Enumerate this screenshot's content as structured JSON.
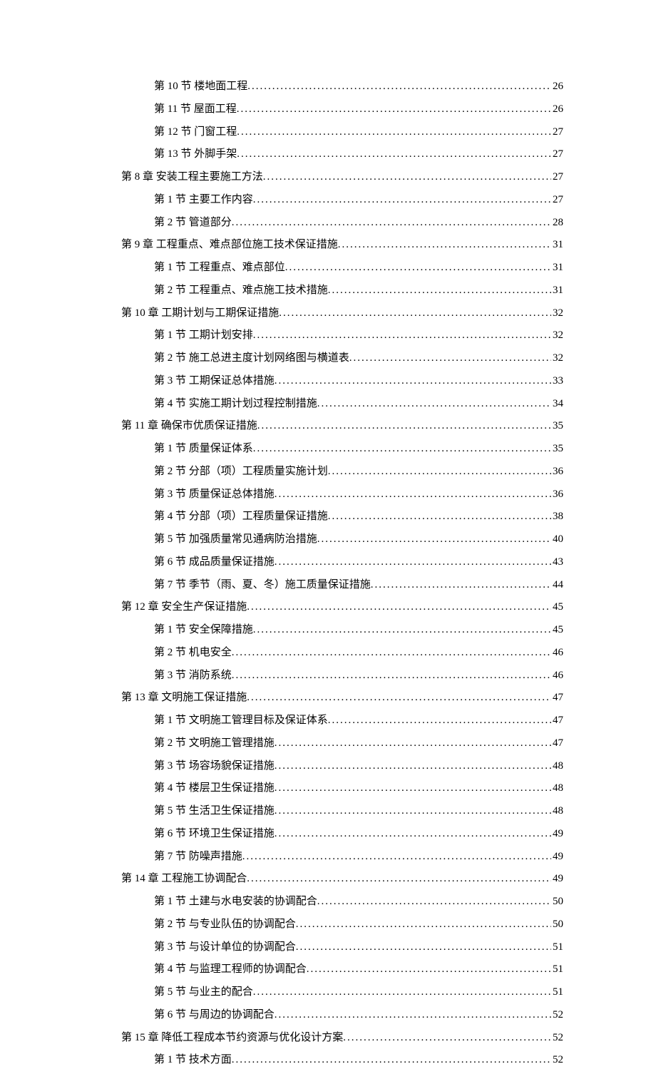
{
  "entries": [
    {
      "level": 2,
      "title": "第 10 节  楼地面工程",
      "page": "26"
    },
    {
      "level": 2,
      "title": "第 11 节  屋面工程",
      "page": "26"
    },
    {
      "level": 2,
      "title": "第 12 节  门窗工程",
      "page": "27"
    },
    {
      "level": 2,
      "title": "第 13 节  外脚手架",
      "page": "27"
    },
    {
      "level": 1,
      "title": "第 8 章  安装工程主要施工方法",
      "page": "27"
    },
    {
      "level": 2,
      "title": "第 1 节  主要工作内容",
      "page": "27"
    },
    {
      "level": 2,
      "title": "第 2 节  管道部分",
      "page": "28"
    },
    {
      "level": 1,
      "title": "第 9 章  工程重点、难点部位施工技术保证措施",
      "page": "31"
    },
    {
      "level": 2,
      "title": "第 1 节  工程重点、难点部位",
      "page": "31"
    },
    {
      "level": 2,
      "title": "第 2 节  工程重点、难点施工技术措施",
      "page": "31"
    },
    {
      "level": 1,
      "title": "第 10 章  工期计划与工期保证措施",
      "page": "32"
    },
    {
      "level": 2,
      "title": "第 1 节  工期计划安排",
      "page": "32"
    },
    {
      "level": 2,
      "title": "第 2 节  施工总进主度计划网络图与横道表",
      "page": "32"
    },
    {
      "level": 2,
      "title": "第 3 节  工期保证总体措施",
      "page": "33"
    },
    {
      "level": 2,
      "title": "第 4 节  实施工期计划过程控制措施",
      "page": "34"
    },
    {
      "level": 1,
      "title": "第 11 章  确保市优质保证措施",
      "page": "35"
    },
    {
      "level": 2,
      "title": "第 1 节  质量保证体系",
      "page": "35"
    },
    {
      "level": 2,
      "title": "第 2 节  分部（项）工程质量实施计划",
      "page": "36"
    },
    {
      "level": 2,
      "title": "第 3 节  质量保证总体措施",
      "page": "36"
    },
    {
      "level": 2,
      "title": "第 4 节  分部（项）工程质量保证措施",
      "page": "38"
    },
    {
      "level": 2,
      "title": "第 5 节  加强质量常见通病防治措施",
      "page": "40"
    },
    {
      "level": 2,
      "title": "第 6 节  成品质量保证措施",
      "page": "43"
    },
    {
      "level": 2,
      "title": "第 7 节  季节（雨、夏、冬）施工质量保证措施",
      "page": "44"
    },
    {
      "level": 1,
      "title": "第 12 章  安全生产保证措施",
      "page": "45"
    },
    {
      "level": 2,
      "title": "第 1 节  安全保障措施",
      "page": "45"
    },
    {
      "level": 2,
      "title": "第 2 节  机电安全",
      "page": "46"
    },
    {
      "level": 2,
      "title": "第 3 节  消防系统",
      "page": "46"
    },
    {
      "level": 1,
      "title": "第 13 章  文明施工保证措施",
      "page": "47"
    },
    {
      "level": 2,
      "title": "第 1 节  文明施工管理目标及保证体系",
      "page": "47"
    },
    {
      "level": 2,
      "title": "第 2 节  文明施工管理措施",
      "page": "47"
    },
    {
      "level": 2,
      "title": "第 3 节  场容场貌保证措施",
      "page": "48"
    },
    {
      "level": 2,
      "title": "第 4 节  楼层卫生保证措施",
      "page": "48"
    },
    {
      "level": 2,
      "title": "第 5 节  生活卫生保证措施",
      "page": "48"
    },
    {
      "level": 2,
      "title": "第 6 节  环境卫生保证措施",
      "page": "49"
    },
    {
      "level": 2,
      "title": "第 7 节  防噪声措施",
      "page": "49"
    },
    {
      "level": 1,
      "title": "第 14 章  工程施工协调配合",
      "page": "49"
    },
    {
      "level": 2,
      "title": "第 1 节  土建与水电安装的协调配合",
      "page": "50"
    },
    {
      "level": 2,
      "title": "第 2 节  与专业队伍的协调配合",
      "page": "50"
    },
    {
      "level": 2,
      "title": "第 3 节  与设计单位的协调配合",
      "page": "51"
    },
    {
      "level": 2,
      "title": "第 4 节  与监理工程师的协调配合",
      "page": "51"
    },
    {
      "level": 2,
      "title": "第 5 节  与业主的配合",
      "page": "51"
    },
    {
      "level": 2,
      "title": "第 6 节  与周边的协调配合",
      "page": "52"
    },
    {
      "level": 1,
      "title": "第 15 章  降低工程成本节约资源与优化设计方案",
      "page": "52"
    },
    {
      "level": 2,
      "title": "第 1 节  技术方面",
      "page": "52"
    }
  ]
}
